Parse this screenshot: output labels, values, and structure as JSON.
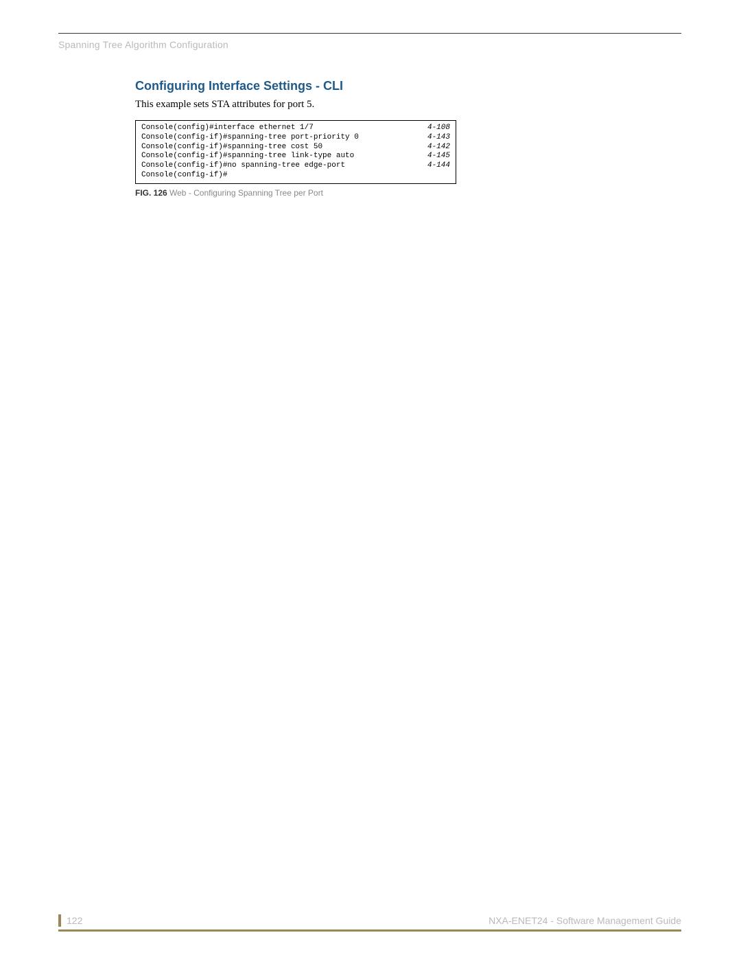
{
  "header": {
    "section_title": "Spanning Tree Algorithm Configuration"
  },
  "section": {
    "heading": "Configuring Interface Settings - CLI",
    "intro": "This example sets STA attributes for port 5."
  },
  "code": {
    "lines": [
      {
        "cmd": "Console(config)#interface ethernet 1/7",
        "ref": "4-108"
      },
      {
        "cmd": "Console(config-if)#spanning-tree port-priority 0",
        "ref": "4-143"
      },
      {
        "cmd": "Console(config-if)#spanning-tree cost 50",
        "ref": "4-142"
      },
      {
        "cmd": "Console(config-if)#spanning-tree link-type auto",
        "ref": "4-145"
      },
      {
        "cmd": "Console(config-if)#no spanning-tree edge-port",
        "ref": "4-144"
      },
      {
        "cmd": "Console(config-if)#",
        "ref": ""
      }
    ]
  },
  "figure": {
    "label": "FIG. 126",
    "caption": "  Web - Configuring Spanning Tree per Port"
  },
  "footer": {
    "page_number": "122",
    "doc_title": "NXA-ENET24 - Software Management Guide"
  }
}
